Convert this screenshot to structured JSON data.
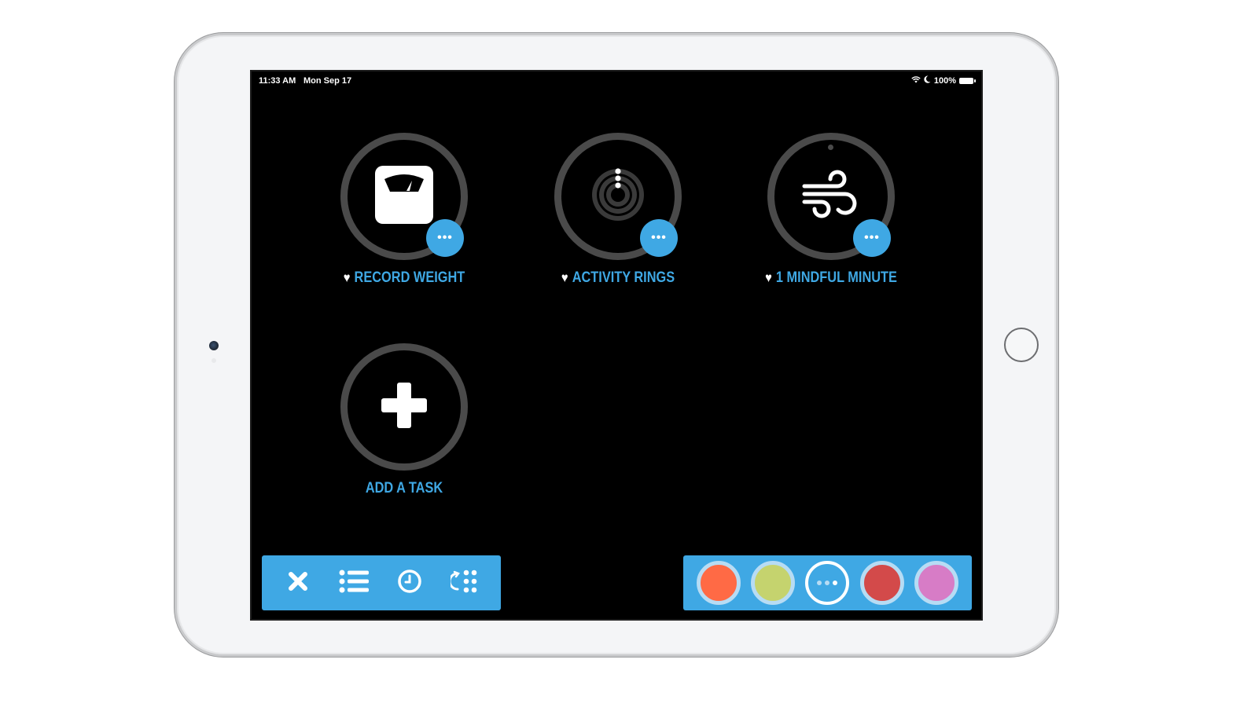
{
  "status_bar": {
    "time": "11:33 AM",
    "date": "Mon Sep 17",
    "battery": "100%",
    "icons": [
      "wifi-icon",
      "moon-icon",
      "battery-icon"
    ]
  },
  "tasks": [
    {
      "label": "RECORD WEIGHT",
      "icon": "scale-icon",
      "favorite": true,
      "more_label": "•••"
    },
    {
      "label": "ACTIVITY RINGS",
      "icon": "activity-rings-icon",
      "favorite": true,
      "more_label": "•••"
    },
    {
      "label": "1 MINDFUL MINUTE",
      "icon": "wind-icon",
      "favorite": true,
      "more_label": "•••"
    },
    {
      "label": "ADD A TASK",
      "icon": "plus-icon",
      "favorite": false
    }
  ],
  "heart_glyph": "♥",
  "toolbar_left": {
    "buttons": [
      "close-icon",
      "list-icon",
      "clock-icon",
      "rearrange-grid-icon"
    ]
  },
  "toolbar_right": {
    "swatches": [
      {
        "name": "orange",
        "color": "#ff6a45"
      },
      {
        "name": "lime",
        "color": "#c5d36e"
      },
      {
        "name": "more",
        "color": ""
      },
      {
        "name": "red",
        "color": "#d34a4a"
      },
      {
        "name": "pink",
        "color": "#d77cc6"
      }
    ]
  },
  "colors": {
    "accent": "#3fa8e4",
    "ring": "#4a4a4a",
    "screen_bg": "#000000"
  }
}
